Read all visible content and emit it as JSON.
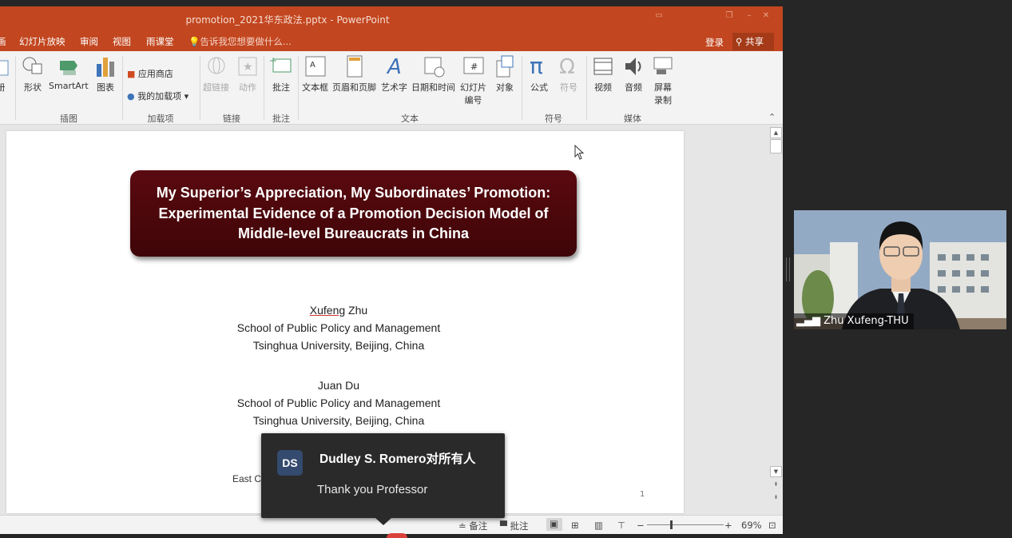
{
  "window": {
    "title": "promotion_2021华东政法.pptx - PowerPoint"
  },
  "menu": {
    "items": [
      "画",
      "幻灯片放映",
      "审阅",
      "视图",
      "雨课堂"
    ],
    "tell_me": "告诉我您想要做什么...",
    "login": "登录",
    "share": "共享"
  },
  "ribbon": {
    "buttons": {
      "book": "册",
      "shape": "形状",
      "smartart": "SmartArt",
      "chart": "图表",
      "store": "应用商店",
      "myaddins": "我的加载项",
      "hyperlink": "超链接",
      "action": "动作",
      "comment": "批注",
      "textbox": "文本框",
      "headerfooter": "页眉和页脚",
      "wordart": "艺术字",
      "datetime": "日期和时间",
      "slidenum1": "幻灯片",
      "slidenum2": "编号",
      "object": "对象",
      "equation": "公式",
      "symbol": "符号",
      "video": "视频",
      "audio": "音频",
      "screenrec1": "屏幕",
      "screenrec2": "录制"
    },
    "groups": {
      "illustrations": "插图",
      "addins": "加载项",
      "links": "链接",
      "comments": "批注",
      "text": "文本",
      "symbols": "符号",
      "media": "媒体"
    }
  },
  "slide": {
    "title_lines": [
      "My Superior’s Appreciation, My Subordinates’ Promotion:",
      "Experimental Evidence of a Promotion Decision Model of",
      "Middle-level Bureaucrats in China"
    ],
    "author1": {
      "first": "Xufeng",
      "last": " Zhu",
      "dept": "School of Public Policy and Management",
      "univ": "Tsinghua University, Beijing, China"
    },
    "author2": {
      "name": "Juan Du",
      "dept": "School of Public Policy and Management",
      "univ": "Tsinghua University, Beijing, China"
    },
    "partial_text": "East C",
    "page_number": "1"
  },
  "statusbar": {
    "notes": "备注",
    "comments": "批注",
    "zoom": "69%"
  },
  "chat_toast": {
    "avatar_initials": "DS",
    "sender": "Dudley S. Romero对所有人",
    "message": "Thank you Professor"
  },
  "video": {
    "participant": "Zhu Xufeng-THU"
  },
  "colors": {
    "ppt_accent": "#c2461f",
    "title_box": "#4a070c",
    "avatar": "#344a6e"
  }
}
